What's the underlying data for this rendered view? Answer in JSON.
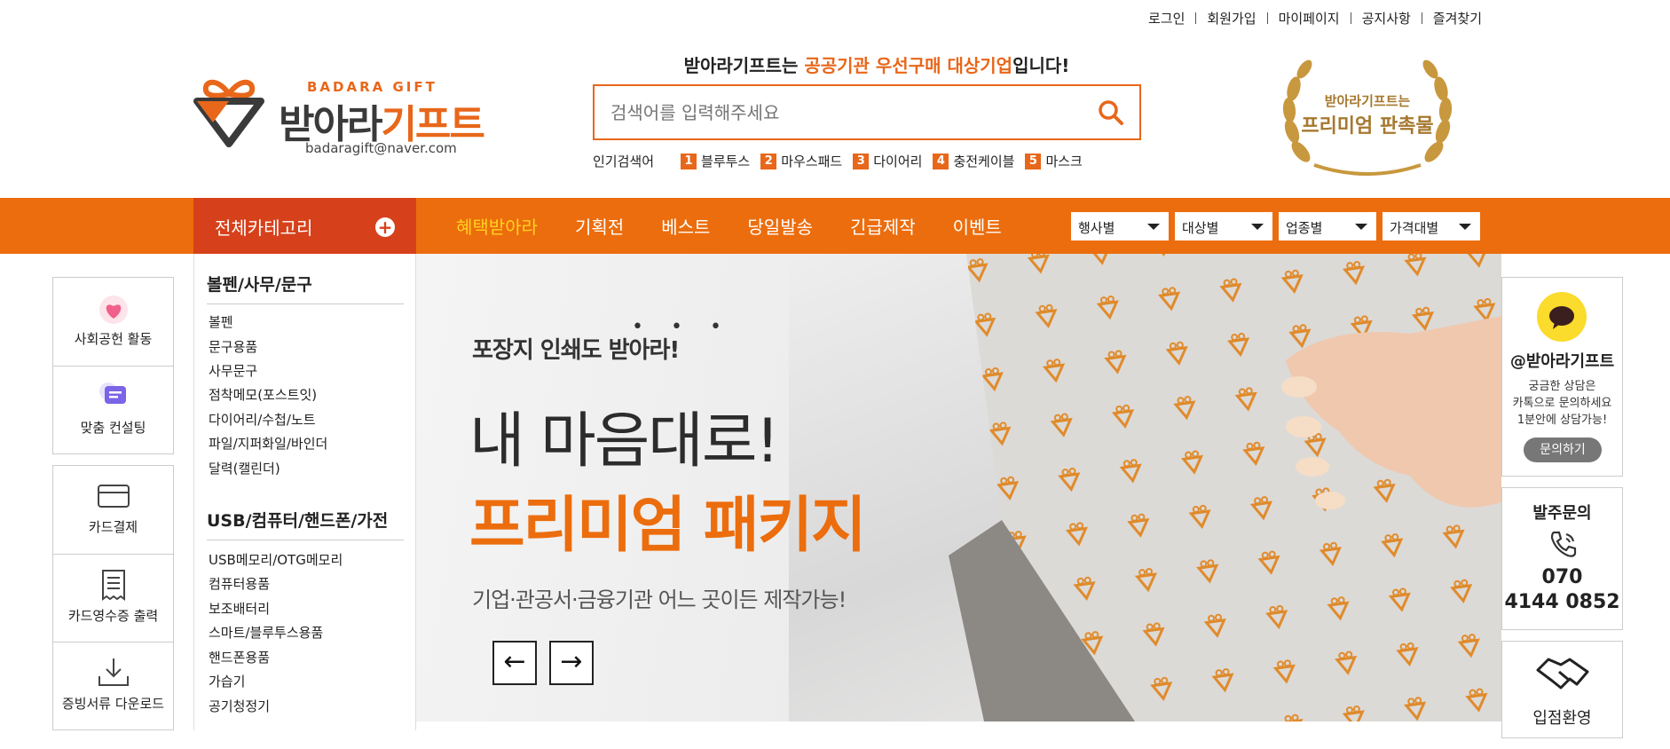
{
  "top_links": [
    "로그인",
    "회원가입",
    "마이페이지",
    "공지사항",
    "즐겨찾기"
  ],
  "logo": {
    "eng": "BADARA GIFT",
    "kor_dark": "받아라",
    "kor_accent": "기프트",
    "email": "badaragift@naver.com"
  },
  "tagline": {
    "pre": "받아라기프트는 ",
    "highlight": "공공기관 우선구매 대상기업",
    "post": "입니다!"
  },
  "search": {
    "placeholder": "검색어를 입력해주세요"
  },
  "popular": {
    "label": "인기검색어",
    "items": [
      {
        "num": "1",
        "text": "블루투스"
      },
      {
        "num": "2",
        "text": "마우스패드"
      },
      {
        "num": "3",
        "text": "다이어리"
      },
      {
        "num": "4",
        "text": "충전케이블"
      },
      {
        "num": "5",
        "text": "마스크"
      }
    ]
  },
  "award": {
    "line1": "받아라기프트는",
    "line2": "프리미엄 판촉물"
  },
  "nav": {
    "all_category": "전체카테고리",
    "menu": [
      "혜택받아라",
      "기획전",
      "베스트",
      "당일발송",
      "긴급제작",
      "이벤트"
    ],
    "filters": [
      "행사별",
      "대상별",
      "업종별",
      "가격대별"
    ]
  },
  "left_float": [
    {
      "label": "사회공헌 활동",
      "icon": "heart-icon"
    },
    {
      "label": "맞춤 컨설팅",
      "icon": "chat-icon"
    },
    {
      "label": "카드결제",
      "icon": "card-icon"
    },
    {
      "label": "카드영수증 출력",
      "icon": "receipt-icon"
    },
    {
      "label": "증빙서류 다운로드",
      "icon": "download-icon"
    }
  ],
  "categories": [
    {
      "title": "볼펜/사무/문구",
      "items": [
        "볼펜",
        "문구용품",
        "사무문구",
        "점착메모(포스트잇)",
        "다이어리/수첩/노트",
        "파일/지퍼화일/바인더",
        "달력(캘린더)"
      ]
    },
    {
      "title": "USB/컴퓨터/핸드폰/가전",
      "items": [
        "USB메모리/OTG메모리",
        "컴퓨터용품",
        "보조배터리",
        "스마트/블루투스용품",
        "핸드폰용품",
        "가습기",
        "공기청정기"
      ]
    }
  ],
  "banner": {
    "dots": "• • •",
    "subtitle": "포장지 인쇄도 받아라!",
    "title1": "내 마음대로!",
    "title2": "프리미엄 패키지",
    "desc": "기업·관공서·금융기관 어느 곳이든 제작가능!",
    "prev": "←",
    "next": "→"
  },
  "right_float": {
    "kakao": {
      "title": "@받아라기프트",
      "desc1": "궁금한 상담은",
      "desc2": "카톡으로 문의하세요",
      "desc3": "1분안에 상담가능!",
      "button": "문의하기"
    },
    "order": {
      "title": "발주문의",
      "phone1": "070",
      "phone2": "4144 0852"
    },
    "partner": {
      "title": "입점환영"
    }
  },
  "colors": {
    "accent": "#ec6d0d",
    "category_bg": "#d6411b",
    "active_menu": "#ffd21e",
    "kakao": "#fbdb2b"
  }
}
